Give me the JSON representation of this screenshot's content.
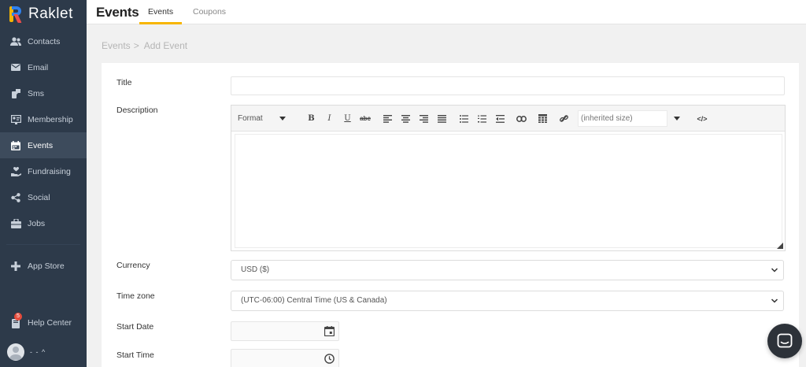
{
  "brand": {
    "name": "Raklet"
  },
  "sidebar": {
    "items": [
      {
        "label": "Contacts",
        "icon": "contacts-icon"
      },
      {
        "label": "Email",
        "icon": "email-icon"
      },
      {
        "label": "Sms",
        "icon": "sms-icon"
      },
      {
        "label": "Membership",
        "icon": "membership-icon"
      },
      {
        "label": "Events",
        "icon": "calendar-icon",
        "active": true
      },
      {
        "label": "Fundraising",
        "icon": "hand-heart-icon"
      },
      {
        "label": "Social",
        "icon": "share-icon"
      },
      {
        "label": "Jobs",
        "icon": "briefcase-icon"
      }
    ],
    "app_store": "App Store",
    "help_center": "Help Center",
    "help_badge": "5",
    "user_menu": "- - ^"
  },
  "header": {
    "title": "Events",
    "tabs": [
      {
        "label": "Events",
        "active": true
      },
      {
        "label": "Coupons"
      }
    ]
  },
  "breadcrumb": {
    "parent": "Events",
    "separator": ">",
    "current": "Add Event"
  },
  "form": {
    "title_label": "Title",
    "title_value": "",
    "description_label": "Description",
    "editor": {
      "format_label": "Format",
      "size_label": "(inherited size)"
    },
    "currency_label": "Currency",
    "currency_value": "USD ($)",
    "timezone_label": "Time zone",
    "timezone_value": "(UTC-06:00) Central Time (US & Canada)",
    "start_date_label": "Start Date",
    "start_time_label": "Start Time"
  },
  "colors": {
    "sidebar_bg": "#2d3a4a",
    "accent": "#f7b500",
    "badge": "#e74c3c"
  }
}
